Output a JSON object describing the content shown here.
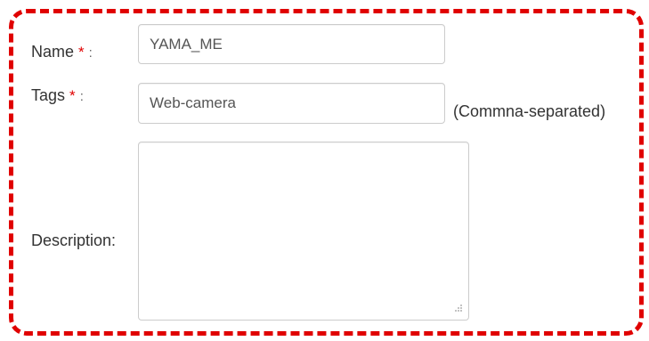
{
  "form": {
    "name": {
      "label": "Name",
      "required_mark": "*",
      "colon": ":",
      "value": "YAMA_ME"
    },
    "tags": {
      "label": "Tags",
      "required_mark": "*",
      "colon": ":",
      "value": "Web-camera",
      "hint": "(Commna-separated)"
    },
    "description": {
      "label": "Description:",
      "value": ""
    }
  },
  "colors": {
    "highlight_border": "#e00000",
    "required_mark": "#e00000",
    "input_border": "#cccccc"
  },
  "icons": {
    "resize_handle": "resize-grip-icon"
  }
}
